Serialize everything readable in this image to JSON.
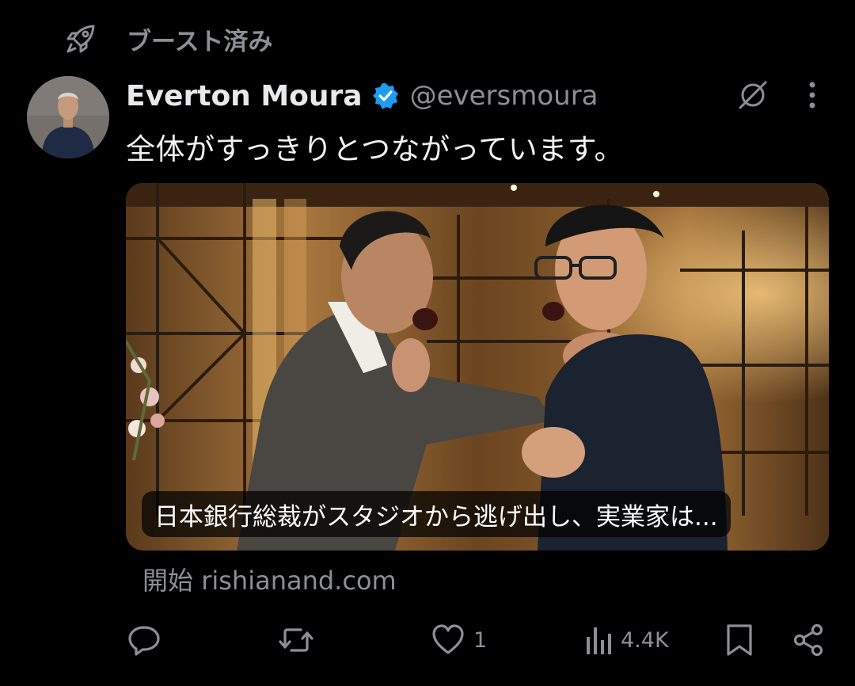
{
  "boost": {
    "label": "ブースト済み",
    "icon": "rocket-icon"
  },
  "author": {
    "display_name": "Everton Moura",
    "handle": "@eversmoura",
    "verified_icon": "verified-badge-icon",
    "avatar": "avatar"
  },
  "post": {
    "text": "全体がすっきりとつながっています。"
  },
  "link_card": {
    "title": "日本銀行総裁がスタジオから逃げ出し、実業家は...",
    "source_prefix": "開始",
    "source_domain": "rishianand.com"
  },
  "actions": {
    "reply_icon": "reply-icon",
    "repost_icon": "repost-icon",
    "like_icon": "heart-icon",
    "like_count": "1",
    "views_icon": "views-bar-chart-icon",
    "views_count": "4.4K",
    "bookmark_icon": "bookmark-icon",
    "share_icon": "share-icon"
  },
  "header_actions": {
    "mute_icon": "mute-icon",
    "more_icon": "more-vertical-icon"
  },
  "colors": {
    "background": "#000000",
    "muted_text": "#8b9096",
    "verified_blue": "#1d9bf0",
    "text": "#e7e9ea"
  }
}
